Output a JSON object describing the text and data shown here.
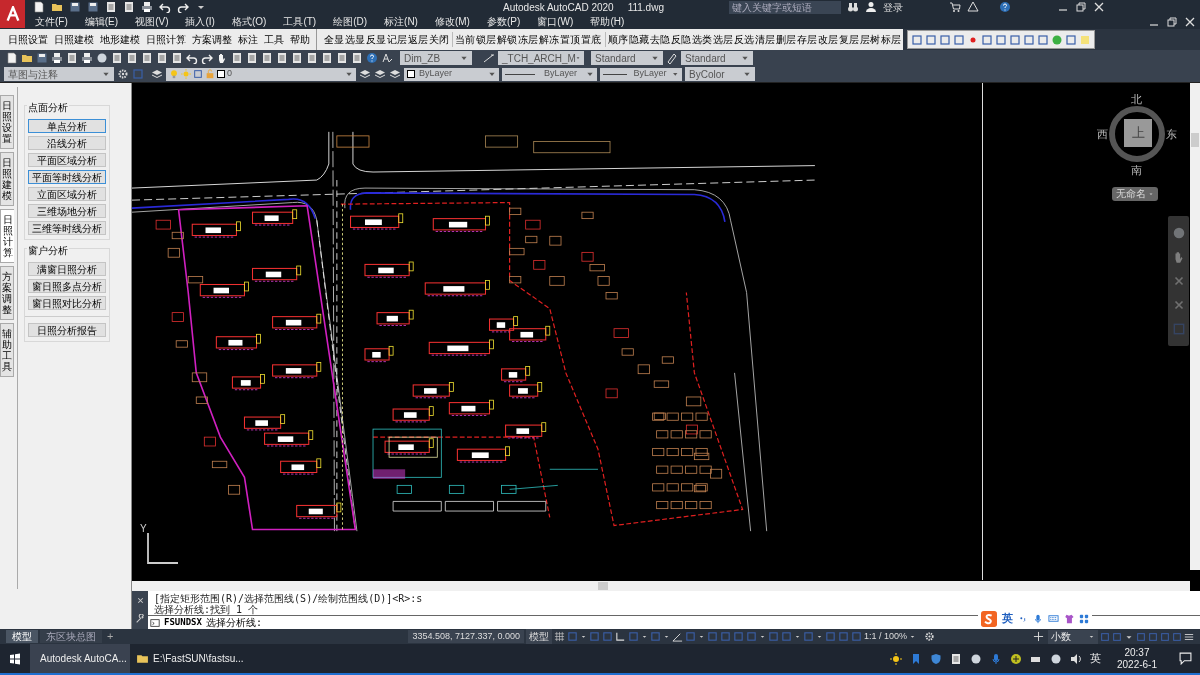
{
  "title_bar": {
    "title": "Autodesk AutoCAD 2020",
    "file": "111.dwg",
    "search": {
      "placeholder": "键入关键字或短语"
    },
    "sign_in": "登录"
  },
  "menu": [
    "文件(F)",
    "编辑(E)",
    "视图(V)",
    "插入(I)",
    "格式(O)",
    "工具(T)",
    "绘图(D)",
    "标注(N)",
    "修改(M)",
    "参数(P)",
    "窗口(W)",
    "帮助(H)"
  ],
  "ribbon_tabs": [
    "日照设置",
    "日照建模",
    "地形建模",
    "日照计算",
    "方案调整",
    "标注",
    "工具",
    "帮助"
  ],
  "layer_commands": [
    "全显",
    "选显",
    "反显",
    "记层",
    "返层",
    "关闭",
    "当前",
    "锁层",
    "解锁",
    "冻层",
    "解冻",
    "置顶",
    "置底",
    "顺序",
    "隐藏",
    "去隐",
    "反隐",
    "选类",
    "选层",
    "反选",
    "清层",
    "删层",
    "存层",
    "改层",
    "复层",
    "层树",
    "标层"
  ],
  "styles": {
    "dimension": "Dim_ZB",
    "multileader": "_TCH_ARCH_M",
    "text": "Standard",
    "table": "Standard"
  },
  "properties": {
    "workspace": "草图与注释",
    "layer": "0",
    "color_control": "ByLayer",
    "linetype": "ByLayer",
    "lineweight": "ByLayer",
    "plot_style": "ByColor"
  },
  "side_panel": {
    "tabs": [
      {
        "label": "日照设置",
        "selected": false
      },
      {
        "label": "日照建模",
        "selected": false
      },
      {
        "label": "日照计算",
        "selected": true
      },
      {
        "label": "方案调整",
        "selected": false
      },
      {
        "label": "辅助工具",
        "selected": false
      }
    ],
    "groups": [
      {
        "title": "点面分析",
        "buttons": [
          {
            "label": "单点分析",
            "focused": true
          },
          {
            "label": "沿线分析",
            "focused": false
          },
          {
            "label": "平面区域分析",
            "focused": false
          },
          {
            "label": "平面等时线分析",
            "focused": true
          },
          {
            "label": "立面区域分析",
            "focused": false
          },
          {
            "label": "三维场地分析",
            "focused": false
          },
          {
            "label": "三维等时线分析",
            "focused": false
          }
        ]
      },
      {
        "title": "窗户分析",
        "buttons": [
          {
            "label": "满窗日照分析",
            "focused": false
          },
          {
            "label": "窗日照多点分析",
            "focused": false
          },
          {
            "label": "窗日照对比分析",
            "focused": false
          }
        ],
        "report": "日照分析报告"
      }
    ]
  },
  "viewcube": {
    "north": "北",
    "south": "南",
    "east": "东",
    "west": "西",
    "face": "上",
    "ucs": "无命名"
  },
  "ucs_axis": "Y",
  "command": {
    "history": [
      "[指定矩形范围(R)/选择范围线(S)/绘制范围线(D)]<R>:s",
      "选择分析线:找到 1 个"
    ],
    "name": "FSUNDSX",
    "prompt": "选择分析线:"
  },
  "layout_tabs": [
    {
      "label": "模型",
      "selected": true
    },
    {
      "label": "东区块总图",
      "selected": false
    }
  ],
  "add_tab": "+",
  "status_bar": {
    "coordinates": "3354.508, 7127.337, 0.000",
    "space": "模型",
    "scale": "1:1 / 100%",
    "units": "小数"
  },
  "ime": {
    "mode": "英"
  },
  "taskbar": {
    "apps": [
      {
        "label": "Autodesk AutoCA...",
        "active": true
      },
      {
        "label": "E:\\FastSUN\\fastsu...",
        "active": false
      }
    ],
    "language": "英",
    "time": "20:37",
    "date": "2022-6-1"
  }
}
